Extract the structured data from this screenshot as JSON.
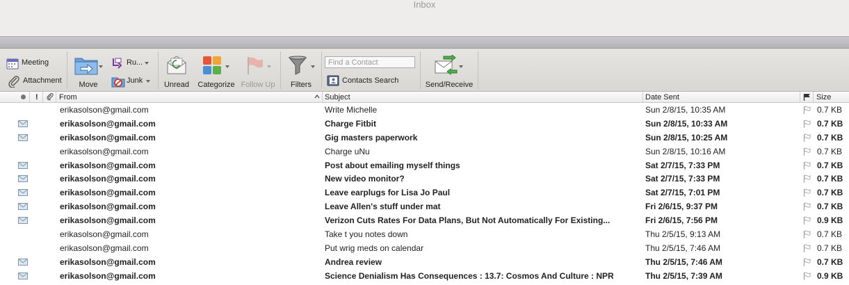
{
  "window": {
    "title": "Inbox"
  },
  "toolbar": {
    "meeting": "Meeting",
    "attachment": "Attachment",
    "move": "Move",
    "rules": "Ru...",
    "junk": "Junk",
    "unread": "Unread",
    "categorize": "Categorize",
    "follow_up": "Follow Up",
    "filters": "Filters",
    "find_contact_placeholder": "Find a Contact",
    "contacts_search": "Contacts Search",
    "send_receive": "Send/Receive"
  },
  "columns": {
    "from": "From",
    "subject": "Subject",
    "date_sent": "Date Sent",
    "size": "Size"
  },
  "messages": [
    {
      "from": "erikasolson@gmail.com",
      "subject": "Write Michelle",
      "date": "Sun 2/8/15, 10:35 AM",
      "size": "0.7 KB",
      "unread": false
    },
    {
      "from": "erikasolson@gmail.com",
      "subject": "Charge Fitbit",
      "date": "Sun 2/8/15, 10:33 AM",
      "size": "0.7 KB",
      "unread": true
    },
    {
      "from": "erikasolson@gmail.com",
      "subject": "Gig masters paperwork",
      "date": "Sun 2/8/15, 10:25 AM",
      "size": "0.7 KB",
      "unread": true
    },
    {
      "from": "erikasolson@gmail.com",
      "subject": "Charge uNu",
      "date": "Sun 2/8/15, 10:16 AM",
      "size": "0.7 KB",
      "unread": false
    },
    {
      "from": "erikasolson@gmail.com",
      "subject": "Post about emailing myself things",
      "date": "Sat 2/7/15, 7:33 PM",
      "size": "0.7 KB",
      "unread": true
    },
    {
      "from": "erikasolson@gmail.com",
      "subject": "New video monitor?",
      "date": "Sat 2/7/15, 7:33 PM",
      "size": "0.7 KB",
      "unread": true
    },
    {
      "from": "erikasolson@gmail.com",
      "subject": "Leave earplugs for Lisa Jo Paul",
      "date": "Sat 2/7/15, 7:01 PM",
      "size": "0.7 KB",
      "unread": true
    },
    {
      "from": "erikasolson@gmail.com",
      "subject": "Leave Allen's stuff under mat",
      "date": "Fri 2/6/15, 9:37 PM",
      "size": "0.7 KB",
      "unread": true
    },
    {
      "from": "erikasolson@gmail.com",
      "subject": "Verizon Cuts Rates For Data Plans, But Not Automatically For Existing...",
      "date": "Fri 2/6/15, 7:56 PM",
      "size": "0.9 KB",
      "unread": true
    },
    {
      "from": "erikasolson@gmail.com",
      "subject": "Take t you notes down",
      "date": "Thu 2/5/15, 9:13 AM",
      "size": "0.7 KB",
      "unread": false
    },
    {
      "from": "erikasolson@gmail.com",
      "subject": "Put wrig meds on calendar",
      "date": "Thu 2/5/15, 7:46 AM",
      "size": "0.7 KB",
      "unread": false
    },
    {
      "from": "erikasolson@gmail.com",
      "subject": "Andrea review",
      "date": "Thu 2/5/15, 7:46 AM",
      "size": "0.7 KB",
      "unread": true
    },
    {
      "from": "erikasolson@gmail.com",
      "subject": "Science Denialism Has Consequences : 13.7: Cosmos And Culture : NPR",
      "date": "Thu 2/5/15, 7:39 AM",
      "size": "0.9 KB",
      "unread": true
    }
  ]
}
